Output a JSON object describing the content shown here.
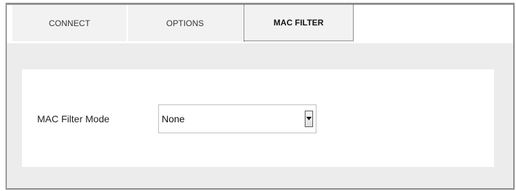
{
  "tabs": [
    {
      "label": "CONNECT",
      "active": false
    },
    {
      "label": "OPTIONS",
      "active": false
    },
    {
      "label": "MAC FILTER",
      "active": true
    }
  ],
  "mac_filter": {
    "mode_label": "MAC Filter Mode",
    "mode_value": "None"
  },
  "icons": {
    "select_arrow": "chevron-down-icon"
  },
  "colors": {
    "tab_bg": "#f2f2f2",
    "content_bg": "#ececec",
    "panel_bg": "#ffffff",
    "frame_border": "#8e8e8e"
  }
}
